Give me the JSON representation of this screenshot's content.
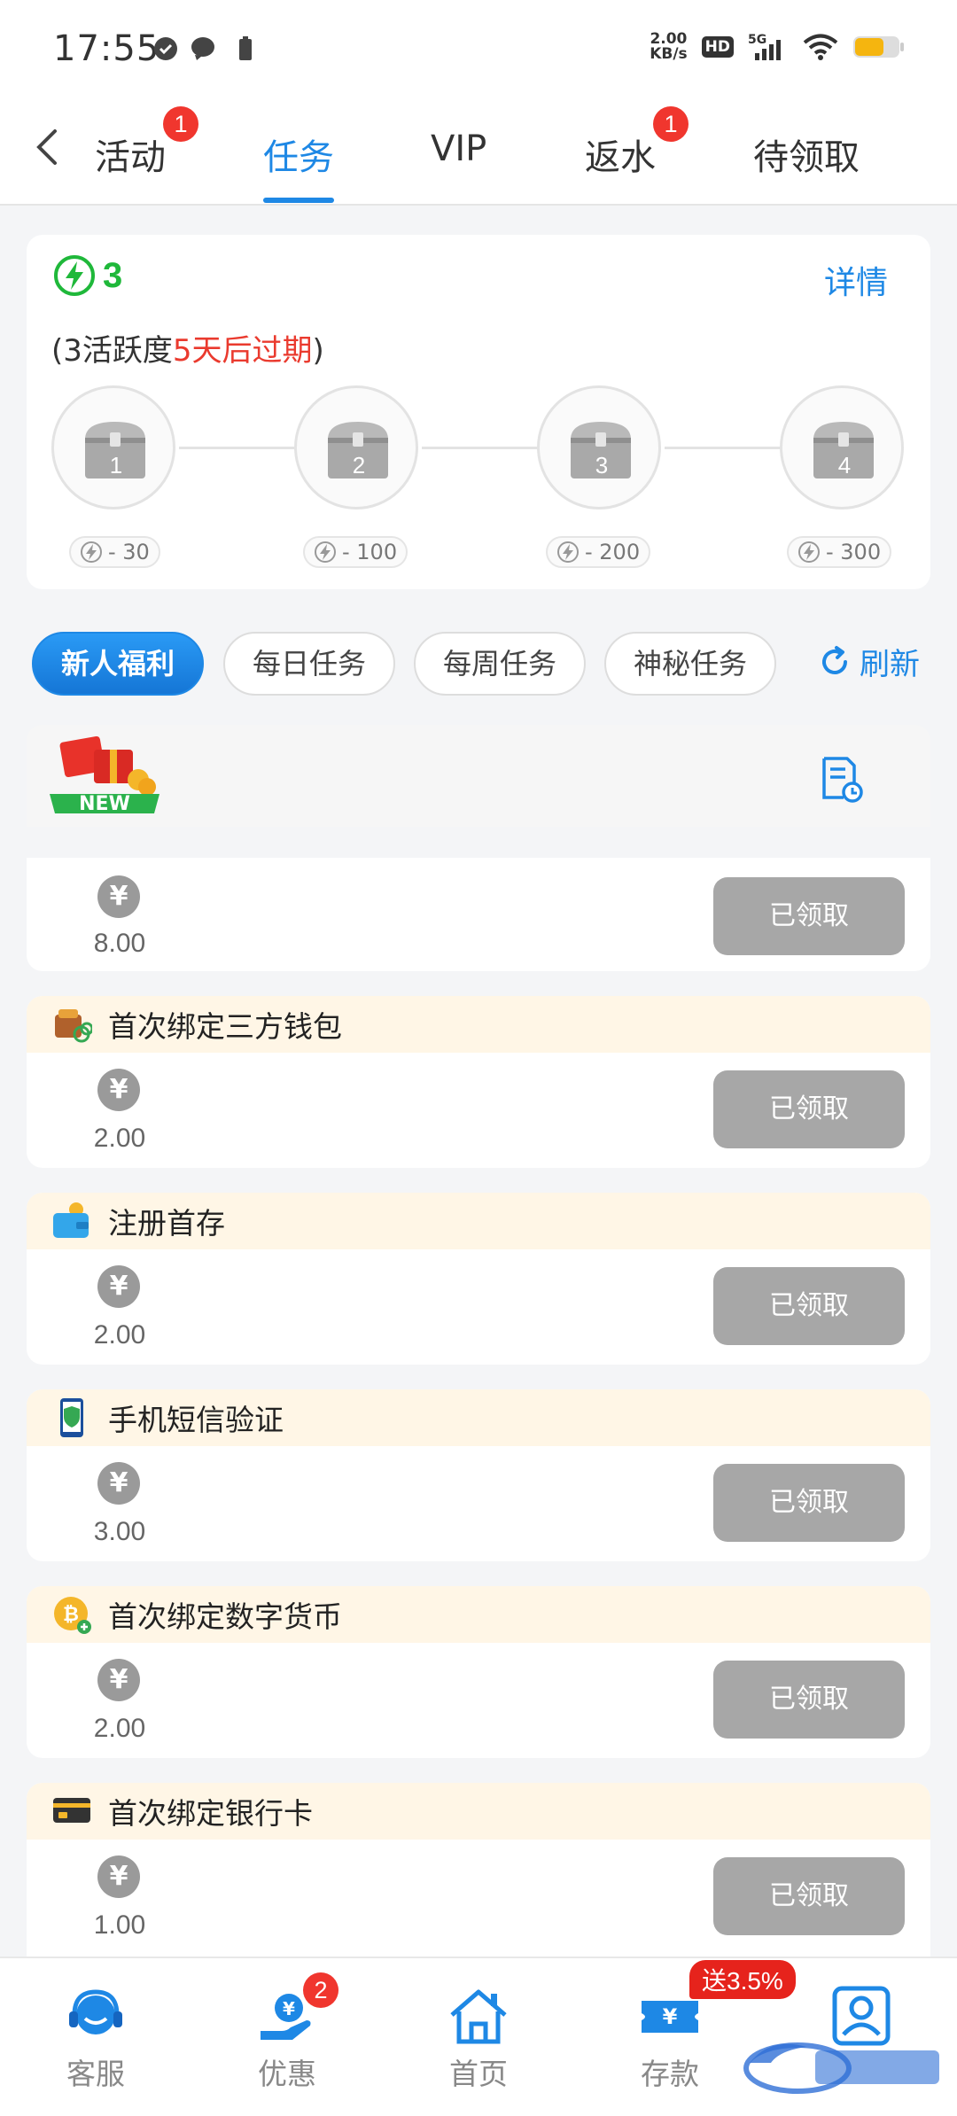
{
  "status_bar": {
    "time": "17:55",
    "net_speed_value": "2.00",
    "net_speed_unit": "KB/s",
    "hd": "HD",
    "network": "5G"
  },
  "nav": {
    "tabs": [
      {
        "label": "活动",
        "badge": "1"
      },
      {
        "label": "任务",
        "active": true
      },
      {
        "label": "VIP"
      },
      {
        "label": "返水",
        "badge": "1"
      },
      {
        "label": "待领取"
      }
    ]
  },
  "activity": {
    "points": "3",
    "detail_label": "详情",
    "subtitle_prefix": "(3活跃度",
    "subtitle_highlight": "5天后过期",
    "subtitle_suffix": ")",
    "chests": [
      {
        "num": "1",
        "cost": "- 30"
      },
      {
        "num": "2",
        "cost": "- 100"
      },
      {
        "num": "3",
        "cost": "- 200"
      },
      {
        "num": "4",
        "cost": "- 300"
      }
    ]
  },
  "categories": {
    "chips": [
      "新人福利",
      "每日任务",
      "每周任务",
      "神秘任务"
    ],
    "refresh_label": "刷新"
  },
  "list_header": {
    "new_badge": "NEW"
  },
  "tasks": [
    {
      "title": "",
      "amount": "8.00",
      "button": "已领取",
      "icon": "gift-icon"
    },
    {
      "title": "首次绑定三方钱包",
      "amount": "2.00",
      "button": "已领取",
      "icon": "wallet-link-icon"
    },
    {
      "title": "注册首存",
      "amount": "2.00",
      "button": "已领取",
      "icon": "coin-wallet-icon"
    },
    {
      "title": "手机短信验证",
      "amount": "3.00",
      "button": "已领取",
      "icon": "phone-shield-icon"
    },
    {
      "title": "首次绑定数字货币",
      "amount": "2.00",
      "button": "已领取",
      "icon": "bitcoin-icon"
    },
    {
      "title": "首次绑定银行卡",
      "amount": "1.00",
      "button": "已领取",
      "icon": "bank-card-icon"
    }
  ],
  "yen_symbol": "¥",
  "bottom_nav": {
    "items": [
      {
        "label": "客服",
        "icon": "headset-icon"
      },
      {
        "label": "优惠",
        "icon": "promo-hand-icon",
        "badge": "2",
        "active": true
      },
      {
        "label": "首页",
        "icon": "home-icon"
      },
      {
        "label": "存款",
        "icon": "deposit-ticket-icon",
        "tag": "送3.5%"
      },
      {
        "label": "",
        "icon": "profile-icon"
      }
    ]
  },
  "colors": {
    "accent": "#1e88e5",
    "badge_red": "#f0362e",
    "points_green": "#1fb83a",
    "highlight_red": "#ea3a2e",
    "claimed_gray": "#a7a7a7"
  }
}
